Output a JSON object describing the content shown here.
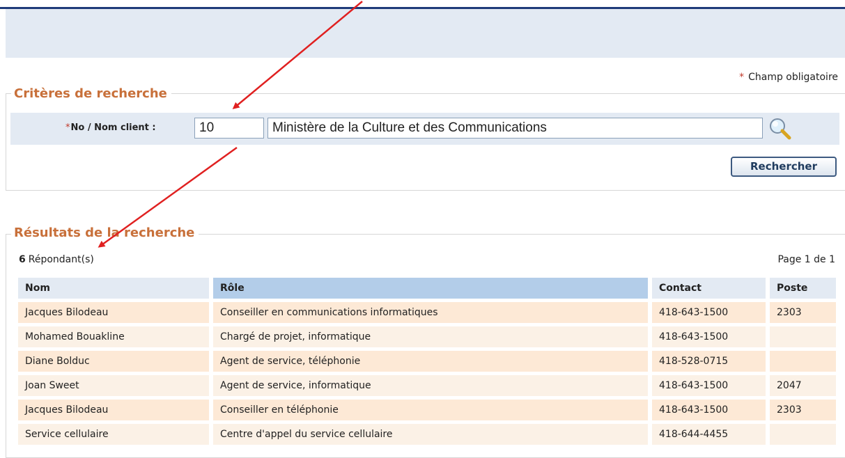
{
  "required_note": {
    "star": "*",
    "text": "Champ obligatoire"
  },
  "criteria": {
    "title": "Critères de recherche",
    "client_label_star": "*",
    "client_label": "No / Nom client :",
    "client_no_value": "10",
    "client_name_value": "Ministère de la Culture et des Communications",
    "search_icon": "magnifier-icon",
    "search_button": "Rechercher"
  },
  "results": {
    "title": "Résultats de la recherche",
    "count": "6",
    "count_label": "Répondant(s)",
    "page_info": "Page 1 de 1",
    "columns": [
      "Nom",
      "Rôle",
      "Contact",
      "Poste"
    ],
    "rows": [
      {
        "nom": "Jacques Bilodeau",
        "role": "Conseiller en communications informatiques",
        "contact": "418-643-1500",
        "poste": "2303"
      },
      {
        "nom": "Mohamed Bouakline",
        "role": "Chargé de projet, informatique",
        "contact": "418-643-1500",
        "poste": ""
      },
      {
        "nom": "Diane Bolduc",
        "role": "Agent de service, téléphonie",
        "contact": "418-528-0715",
        "poste": ""
      },
      {
        "nom": "Joan Sweet",
        "role": "Agent de service, informatique",
        "contact": "418-643-1500",
        "poste": "2047"
      },
      {
        "nom": "Jacques Bilodeau",
        "role": "Conseiller en téléphonie",
        "contact": "418-643-1500",
        "poste": "2303"
      },
      {
        "nom": "Service cellulaire",
        "role": "Centre d'appel du service cellulaire",
        "contact": "418-644-4455",
        "poste": ""
      }
    ]
  },
  "colors": {
    "accent": "#c8703a",
    "header_blue": "#1f3b7a",
    "annotation_arrow": "#e02020"
  }
}
